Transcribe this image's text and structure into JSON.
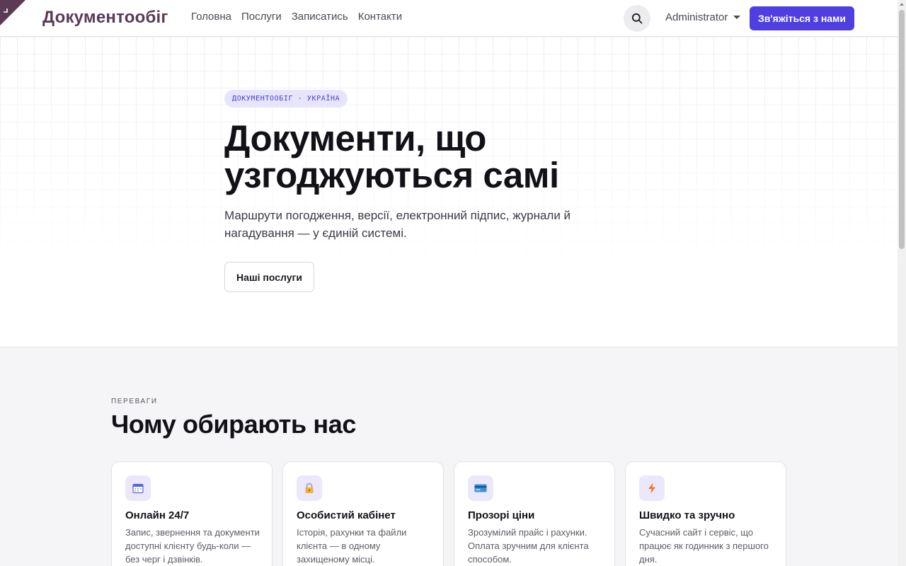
{
  "header": {
    "logo": "Документообіг",
    "nav": [
      "Головна",
      "Послуги",
      "Записатись",
      "Контакти"
    ],
    "user": "Administrator",
    "cta": "Зв'яжіться з нами"
  },
  "hero": {
    "eyebrow": "ДОКУМЕНТООБІГ · УКРАЇНА",
    "title": "Документи, що узгоджуються самі",
    "subtitle": "Маршрути погодження, версії, електронний підпис, журнали й нагадування — у єдиній системі.",
    "button": "Наші послуги"
  },
  "features": {
    "eyebrow": "ПЕРЕВАГИ",
    "title": "Чому обирають нас",
    "cards": [
      {
        "icon": "calendar-icon",
        "title": "Онлайн 24/7",
        "text": "Запис, звернення та документи доступні клієнту будь-коли — без черг і дзвінків."
      },
      {
        "icon": "lock-icon",
        "title": "Особистий кабінет",
        "text": "Історія, рахунки та файли клієнта — в одному захищеному місці."
      },
      {
        "icon": "credit-card-icon",
        "title": "Прозорі ціни",
        "text": "Зрозумілий прайс і рахунки. Оплата зручним для клієнта способом."
      },
      {
        "icon": "lightning-icon",
        "title": "Швидко та зручно",
        "text": "Сучасний сайт і сервіс, що працює як годинник з першого дня."
      }
    ]
  },
  "colors": {
    "accent": "#4f3fe0",
    "logo": "#5b3a56",
    "pill_bg": "#e7e5fb"
  }
}
